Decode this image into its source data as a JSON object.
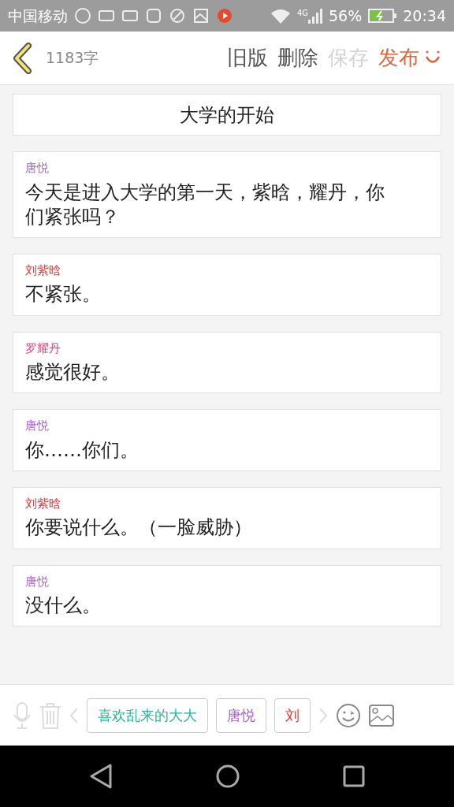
{
  "status_bar": {
    "carrier": "中国移动",
    "battery": "56%",
    "time": "20:34",
    "network": "4G"
  },
  "header": {
    "word_count": "1183字",
    "actions": [
      {
        "label": "旧版",
        "kind": "normal"
      },
      {
        "label": "删除",
        "kind": "normal"
      },
      {
        "label": "保存",
        "kind": "disabled"
      },
      {
        "label": "发布",
        "kind": "primary"
      }
    ]
  },
  "title": "大学的开始",
  "messages": [
    {
      "speaker": "唐悦",
      "color": "#a55fd0",
      "text": "今天是进入大学的第一天，紫晗，耀丹，你们紧张吗？"
    },
    {
      "speaker": "刘紫晗",
      "color": "#e53935",
      "text": "不紧张。"
    },
    {
      "speaker": "罗耀丹",
      "color": "#e8407e",
      "text": "感觉很好。"
    },
    {
      "speaker": "唐悦",
      "color": "#a55fd0",
      "text": "你……你们。"
    },
    {
      "speaker": "刘紫晗",
      "color": "#e53935",
      "text": "你要说什么。（一脸威胁）"
    },
    {
      "speaker": "唐悦",
      "color": "#a55fd0",
      "text": "没什么。"
    }
  ],
  "roles": [
    {
      "label": "喜欢乱来的大大",
      "color": "#26b39a"
    },
    {
      "label": "唐悦",
      "color": "#a55fd0"
    },
    {
      "label": "刘",
      "color": "#e53935"
    }
  ]
}
